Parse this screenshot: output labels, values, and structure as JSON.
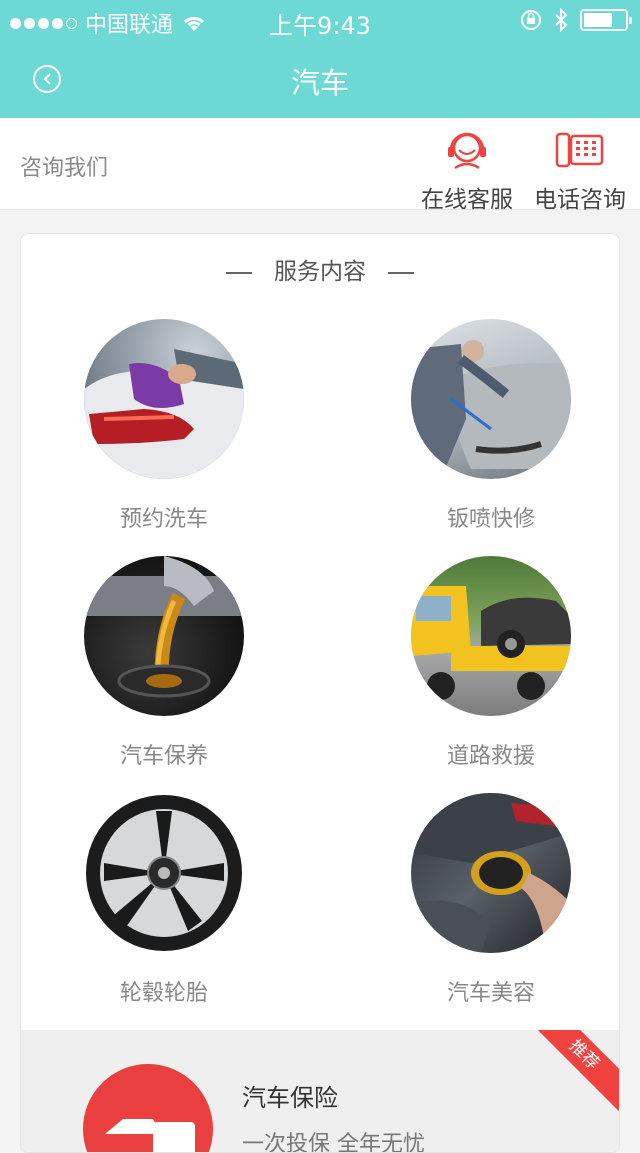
{
  "status_bar": {
    "carrier": "中国联通",
    "time": "上午9:43"
  },
  "nav": {
    "title": "汽车"
  },
  "consult": {
    "label": "咨询我们",
    "online_label": "在线客服",
    "phone_label": "电话咨询"
  },
  "services": {
    "section_title": "服务内容",
    "items": [
      {
        "label": "预约洗车"
      },
      {
        "label": "钣喷快修"
      },
      {
        "label": "汽车保养"
      },
      {
        "label": "道路救援"
      },
      {
        "label": "轮毂轮胎"
      },
      {
        "label": "汽车美容"
      }
    ]
  },
  "promo": {
    "title": "汽车保险",
    "subtitle": "一次投保 全年无忧",
    "badge": "推荐",
    "icon_char": "保"
  },
  "colors": {
    "header": "#6dd9d4",
    "accent_red": "#f0433f"
  }
}
